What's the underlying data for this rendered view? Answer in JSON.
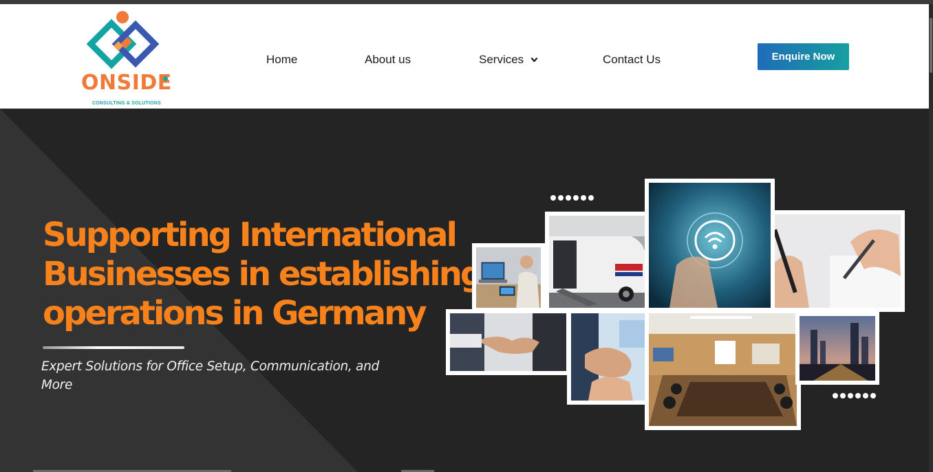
{
  "header": {
    "logo": {
      "word": "ONSIDE",
      "tagline": "CONSULTING & SOLUTIONS",
      "icon": "onside-logo-icon",
      "colors": {
        "orange": "#f07a38",
        "teal": "#13a3a3",
        "blue": "#3a58b0"
      }
    },
    "nav": [
      {
        "label": "Home"
      },
      {
        "label": "About us"
      },
      {
        "label": "Services",
        "icon": "chevron-down-icon"
      },
      {
        "label": "Contact Us"
      }
    ],
    "cta": {
      "label": "Enquire Now",
      "color": "#1f7ab3"
    }
  },
  "hero": {
    "headline": "Supporting International Businesses in establishing operations in Germany",
    "subheading": "Expert Solutions for Office Setup, Communication, and More",
    "accent_color": "#f7821c",
    "collage": [
      {
        "name": "laptop-tablet-photo"
      },
      {
        "name": "van-ramp-photo"
      },
      {
        "name": "wifi-tech-photo"
      },
      {
        "name": "pen-signing-photo"
      },
      {
        "name": "handshake-photo"
      },
      {
        "name": "hands-together-photo"
      },
      {
        "name": "conference-room-photo"
      },
      {
        "name": "city-skyline-photo"
      }
    ]
  }
}
